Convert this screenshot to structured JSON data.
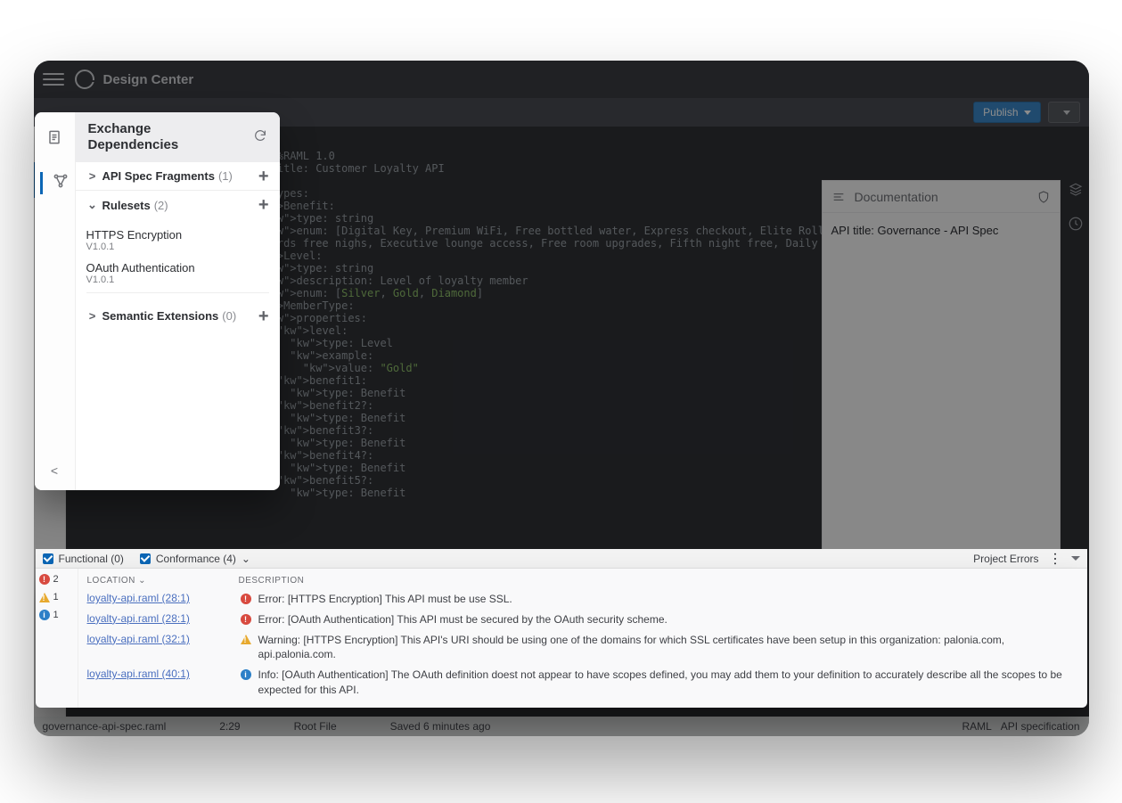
{
  "app_title": "Design Center",
  "subbar": {
    "publish_label": "Publish"
  },
  "popup": {
    "title1": "Exchange",
    "title2": "Dependencies",
    "sections": {
      "fragments": {
        "label": "API Spec Fragments",
        "count": "(1)"
      },
      "rulesets": {
        "label": "Rulesets",
        "count": "(2)"
      },
      "semantic": {
        "label": "Semantic Extensions",
        "count": "(0)"
      }
    },
    "rulesets": [
      {
        "name": "HTTPS Encryption",
        "version": "V1.0.1"
      },
      {
        "name": "OAuth Authentication",
        "version": "V1.0.1"
      }
    ]
  },
  "editor": {
    "code": "#%RAML 1.0\ntitle: Customer Loyalty API\n\ntypes:\n  Benefit:\n    type: string\n    enum: [Digital Key, Premium WiFi, Free bottled water, Express checkout, Elite Rollover nights, Points\n  towards free nighs, Executive lounge access, Free room upgrades, Fifth night free, Daily beverage credit]\n  Level:\n    type: string\n    description: Level of loyalty member\n    enum: [Silver, Gold, Diamond]\n  MemberType:\n    properties:\n      level:\n        type: Level\n        example:\n          value: \"Gold\"\n      benefit1:\n        type: Benefit\n      benefit2?:\n        type: Benefit\n      benefit3?:\n        type: Benefit\n      benefit4?:\n        type: Benefit\n      benefit5?:\n        type: Benefit"
  },
  "doc": {
    "panel_title": "Documentation",
    "content": "API title: Governance - API Spec"
  },
  "problems": {
    "tabs": {
      "functional": "Functional (0)",
      "conformance": "Conformance (4)",
      "project_errors": "Project Errors"
    },
    "summary": {
      "errors": "2",
      "warnings": "1",
      "info": "1"
    },
    "headers": {
      "location": "LOCATION",
      "description": "DESCRIPTION"
    },
    "rows": [
      {
        "sev": "err",
        "loc": "loyalty-api.raml (28:1)",
        "msg": "Error: [HTTPS Encryption] This API must be use SSL."
      },
      {
        "sev": "err",
        "loc": "loyalty-api.raml (28:1)",
        "msg": "Error: [OAuth Authentication] This API must be secured by the OAuth security scheme."
      },
      {
        "sev": "warn",
        "loc": "loyalty-api.raml (32:1)",
        "msg": "Warning: [HTTPS Encryption] This API's URI should be using one of the domains for which SSL certificates have been setup in this organization: palonia.com, api.palonia.com."
      },
      {
        "sev": "info",
        "loc": "loyalty-api.raml (40:1)",
        "msg": "Info: [OAuth Authentication] The OAuth definition doest not appear to have scopes defined, you may add them to your definition to accurately describe all the scopes to be expected for this API."
      }
    ]
  },
  "status": {
    "file": "governance-api-spec.raml",
    "cursor": "2:29",
    "root": "Root File",
    "saved": "Saved 6 minutes ago",
    "lang": "RAML",
    "type": "API specification"
  }
}
